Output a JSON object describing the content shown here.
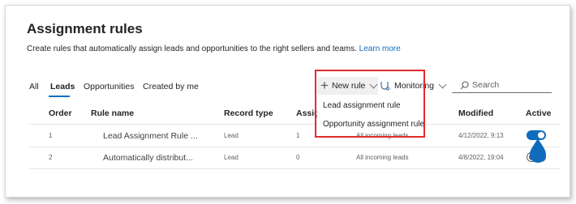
{
  "header": {
    "title": "Assignment rules",
    "description": "Create rules that automatically assign leads and opportunities to the right sellers and teams.",
    "learn_more": "Learn more"
  },
  "tabs": [
    "All",
    "Leads",
    "Opportunities",
    "Created by me"
  ],
  "active_tab": "Leads",
  "commands": {
    "new_rule": "New rule",
    "monitoring": "Monitoring",
    "search_placeholder": "Search"
  },
  "new_rule_menu": [
    "Lead assignment rule",
    "Opportunity assignment rule"
  ],
  "table": {
    "columns": [
      "Order",
      "Rule name",
      "Record type",
      "Assign",
      "",
      "Modified",
      "Active"
    ],
    "rows": [
      {
        "order": "1",
        "name": "Lead Assignment Rule ...",
        "record_type": "Lead",
        "assign": "1",
        "segment": "All incoming leads",
        "modified": "4/12/2022, 9:13",
        "active": true
      },
      {
        "order": "2",
        "name": "Automatically distribut...",
        "record_type": "Lead",
        "assign": "0",
        "segment": "All incoming leads",
        "modified": "4/8/2022, 19:04",
        "active": false
      }
    ]
  },
  "colors": {
    "accent": "#0f6cbd",
    "highlight_border": "#e32b2b"
  },
  "icons": [
    "plus-icon",
    "chevron-down-icon",
    "monitoring-icon",
    "search-icon",
    "pointer-cursor-icon"
  ]
}
